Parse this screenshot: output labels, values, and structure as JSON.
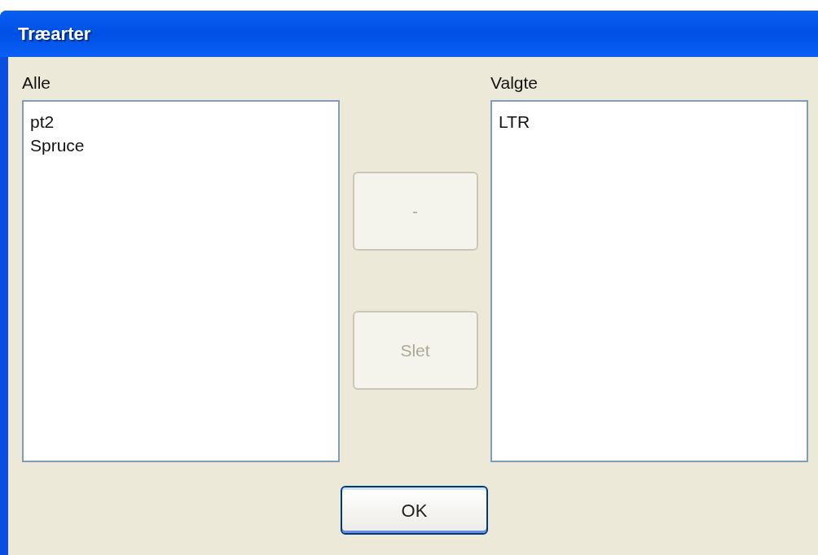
{
  "window": {
    "title": "Træarter"
  },
  "lists": [
    {
      "label": "Alle",
      "items": [
        "pt2",
        "Spruce"
      ]
    },
    {
      "label": "Valgte",
      "items": [
        "LTR"
      ]
    }
  ],
  "middle_buttons": [
    {
      "label": "-",
      "disabled": true
    },
    {
      "label": "Slet",
      "disabled": true
    }
  ],
  "ok_button": {
    "label": "OK",
    "default": true
  }
}
